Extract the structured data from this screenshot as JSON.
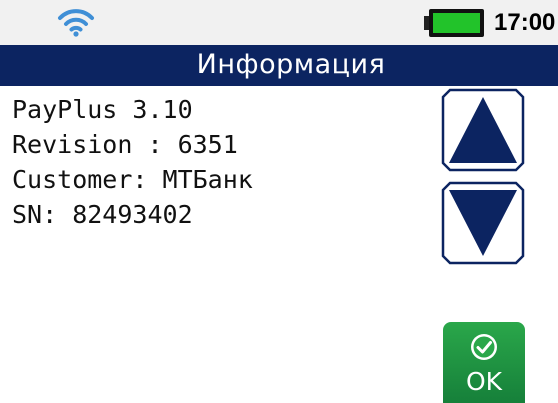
{
  "status_bar": {
    "time": "17:00",
    "wifi_icon": "wifi-icon",
    "battery_icon": "battery-icon",
    "battery_color": "#22c32a"
  },
  "title_bar": {
    "title": "Информация",
    "background_color": "#0c2461"
  },
  "info": {
    "lines": [
      "PayPlus 3.10",
      "Revision : 6351",
      "Customer: МТБанк",
      "SN: 82493402"
    ]
  },
  "scroll": {
    "up_icon": "arrow-up-icon",
    "down_icon": "arrow-down-icon",
    "arrow_color": "#0c2461"
  },
  "ok_button": {
    "label": "OK",
    "icon": "check-icon",
    "color": "#1f9a43"
  }
}
